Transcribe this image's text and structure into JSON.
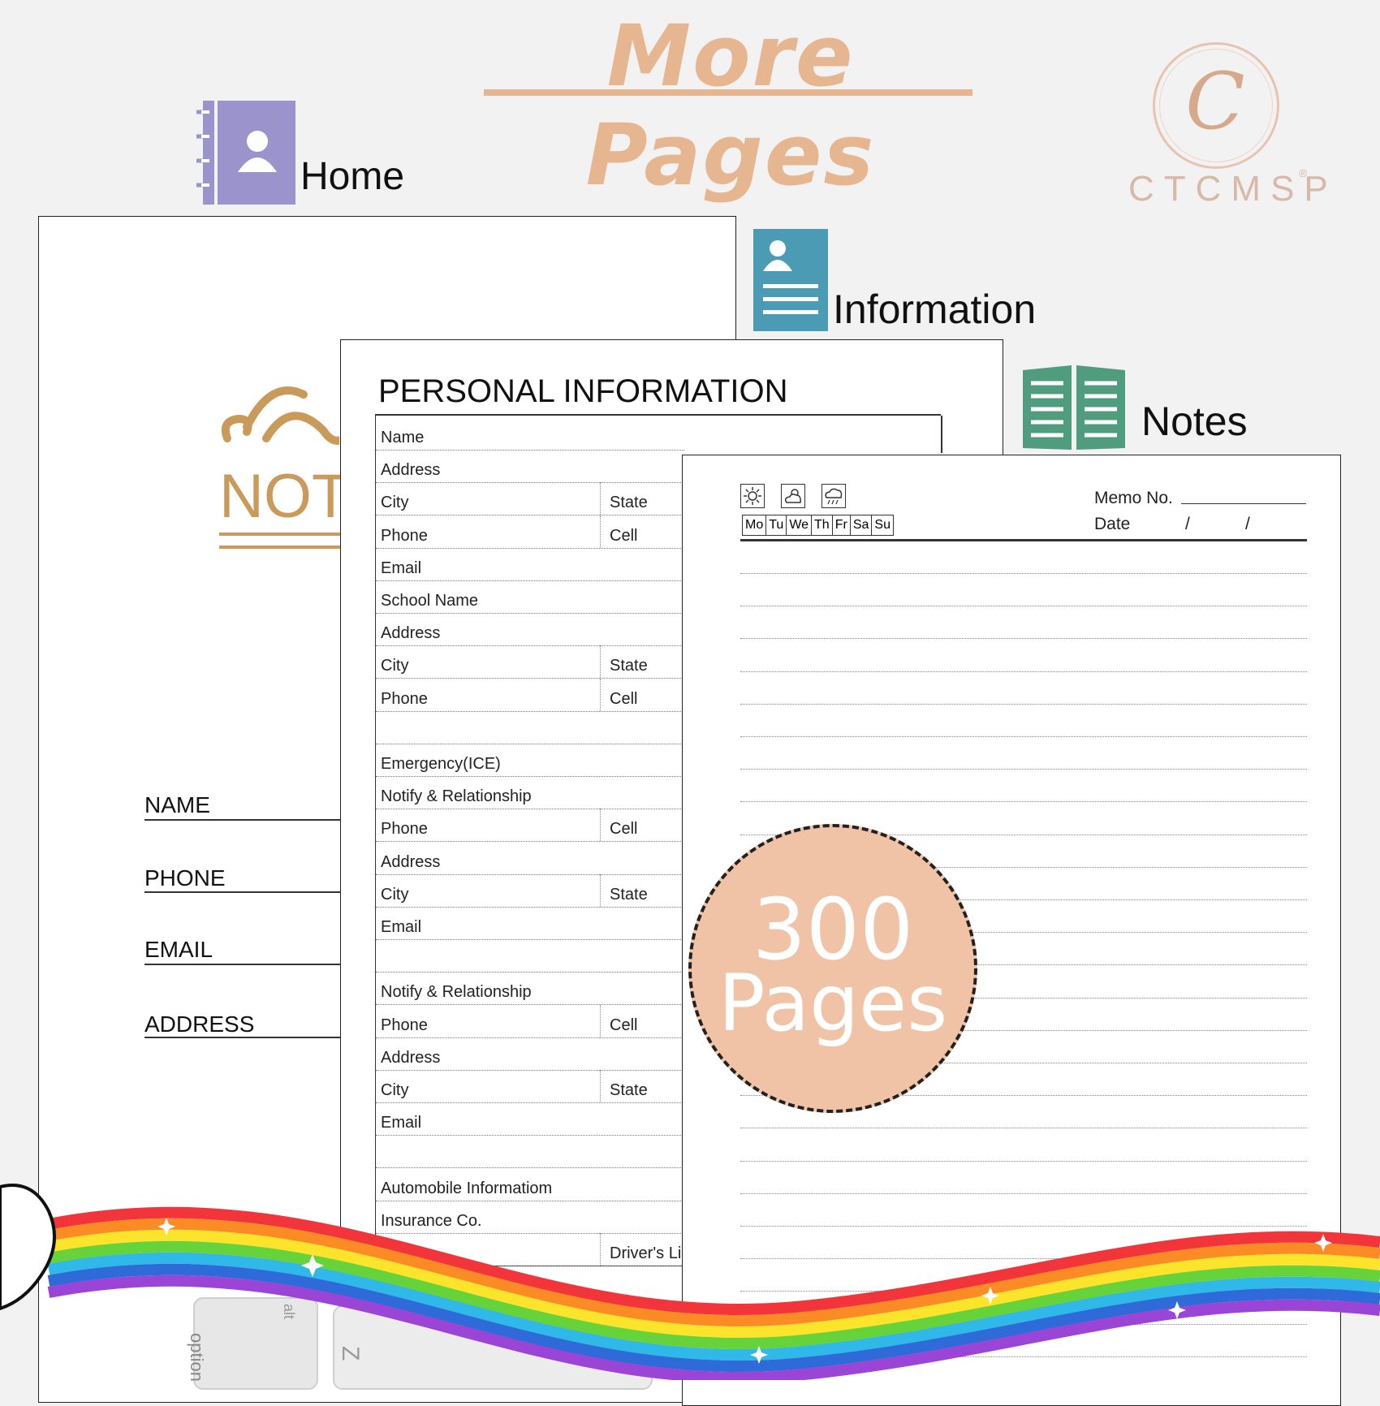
{
  "headline": "More Pages",
  "brand": {
    "logo_letter": "C",
    "name": "CTCMSP",
    "registered": "®"
  },
  "tabs": {
    "home": {
      "label": "Home",
      "icon": "address-book-icon",
      "color": "#9b93cc"
    },
    "information": {
      "label": "Information",
      "icon": "profile-card-icon",
      "color": "#4a9bb3"
    },
    "notes": {
      "label": "Notes",
      "icon": "open-book-icon",
      "color": "#4f9c7e"
    }
  },
  "cover": {
    "title_partial": "NOT",
    "fields": [
      "NAME",
      "PHONE",
      "EMAIL",
      "ADDRESS"
    ],
    "accent_color": "#c99a5a"
  },
  "personal_info": {
    "title": "PERSONAL INFORMATION",
    "rows": [
      {
        "label": "Name"
      },
      {
        "label": "Address"
      },
      {
        "label": "City",
        "right": "State"
      },
      {
        "label": "Phone",
        "right": "Cell"
      },
      {
        "label": "Email"
      },
      {
        "label": "School Name"
      },
      {
        "label": "Address"
      },
      {
        "label": "City",
        "right": "State"
      },
      {
        "label": "Phone",
        "right": "Cell"
      },
      {
        "label": ""
      },
      {
        "label": "Emergency(ICE)"
      },
      {
        "label": "Notify & Relationship"
      },
      {
        "label": "Phone",
        "right": "Cell"
      },
      {
        "label": "Address"
      },
      {
        "label": "City",
        "right": "State"
      },
      {
        "label": "Email"
      },
      {
        "label": ""
      },
      {
        "label": "Notify & Relationship"
      },
      {
        "label": "Phone",
        "right": "Cell"
      },
      {
        "label": "Address"
      },
      {
        "label": "City",
        "right": "State"
      },
      {
        "label": "Email"
      },
      {
        "label": ""
      },
      {
        "label": "Automobile Informatiom"
      },
      {
        "label": "Insurance Co."
      },
      {
        "label": "",
        "right": "Driver's Li"
      }
    ]
  },
  "notes_page": {
    "weather_icons": [
      "sun-icon",
      "partly-cloudy-icon",
      "rain-cloud-icon"
    ],
    "days": [
      "Mo",
      "Tu",
      "We",
      "Th",
      "Fr",
      "Sa",
      "Su"
    ],
    "memo_label": "Memo No.",
    "date_label": "Date",
    "date_sep": "/"
  },
  "badge": {
    "number": "300",
    "label": "Pages",
    "color": "#f1c3a6"
  },
  "keyboard_keys": [
    "option",
    "alt",
    "Z"
  ]
}
